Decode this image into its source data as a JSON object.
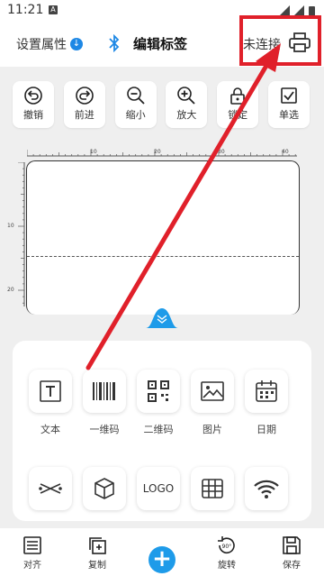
{
  "status_bar": {
    "time": "11:21",
    "notification_icon": "A"
  },
  "app_bar": {
    "set_properties": "设置属性",
    "title": "编辑标签",
    "connection_status": "未连接"
  },
  "toolbar": [
    {
      "label": "撤销",
      "icon": "undo-icon"
    },
    {
      "label": "前进",
      "icon": "redo-icon"
    },
    {
      "label": "缩小",
      "icon": "zoom-out-icon"
    },
    {
      "label": "放大",
      "icon": "zoom-in-icon"
    },
    {
      "label": "锁定",
      "icon": "lock-icon"
    },
    {
      "label": "单选",
      "icon": "checkbox-icon"
    }
  ],
  "ruler": {
    "top_ticks": [
      "10",
      "20",
      "30",
      "40"
    ],
    "left_ticks": [
      "10",
      "20"
    ]
  },
  "elements_panel": {
    "row1": [
      {
        "label": "文本",
        "icon": "text-icon"
      },
      {
        "label": "一维码",
        "icon": "barcode-icon"
      },
      {
        "label": "二维码",
        "icon": "qrcode-icon"
      },
      {
        "label": "图片",
        "icon": "image-icon"
      },
      {
        "label": "日期",
        "icon": "calendar-icon"
      }
    ],
    "row2_logo_text": "LOGO"
  },
  "bottom_bar": {
    "align": "对齐",
    "copy": "复制",
    "rotate": "旋转",
    "rotate_badge": "90°",
    "save": "保存"
  },
  "colors": {
    "accent": "#1e9be9",
    "highlight": "#e0202a"
  }
}
